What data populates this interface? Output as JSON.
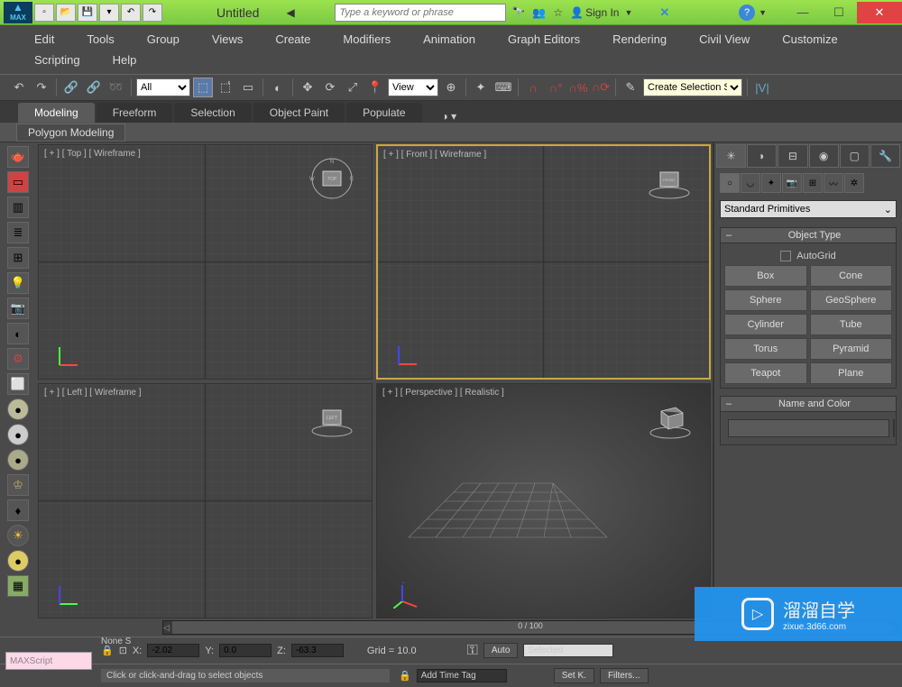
{
  "app": {
    "logo_text": "MAX",
    "title": "Untitled"
  },
  "titlebar": {
    "search_placeholder": "Type a keyword or phrase",
    "signin": "Sign In"
  },
  "menu": {
    "items": [
      "Edit",
      "Tools",
      "Group",
      "Views",
      "Create",
      "Modifiers",
      "Animation",
      "Graph Editors",
      "Rendering",
      "Civil View",
      "Customize",
      "Scripting",
      "Help"
    ]
  },
  "toolbar": {
    "filter_all": "All",
    "view_label": "View",
    "named_sel": "Create Selection Se"
  },
  "ribbon": {
    "tabs": [
      "Modeling",
      "Freeform",
      "Selection",
      "Object Paint",
      "Populate"
    ],
    "subtab": "Polygon Modeling"
  },
  "viewports": {
    "tl": "[ + ] [ Top ] [ Wireframe ]",
    "tr": "[ + ] [ Front ] [ Wireframe ]",
    "bl": "[ + ] [ Left ] [ Wireframe ]",
    "br": "[ + ] [ Perspective ] [ Realistic ]",
    "cube_top": "TOP",
    "cube_front": "FRONT",
    "cube_left": "LEFT"
  },
  "cmd": {
    "dropdown": "Standard Primitives",
    "rollout_obj": "Object Type",
    "autogrid": "AutoGrid",
    "buttons": [
      "Box",
      "Cone",
      "Sphere",
      "GeoSphere",
      "Cylinder",
      "Tube",
      "Torus",
      "Pyramid",
      "Teapot",
      "Plane"
    ],
    "rollout_name": "Name and Color"
  },
  "timeline": {
    "range": "0 / 100"
  },
  "status": {
    "none": "None S",
    "x_label": "X:",
    "x_val": "-2.02",
    "y_label": "Y:",
    "y_val": "0.0",
    "z_label": "Z:",
    "z_val": "-63.3",
    "grid": "Grid = 10.0",
    "auto": "Auto",
    "setk": "Set K.",
    "selected": "Selected",
    "filters": "Filters...",
    "addtag": "Add Time Tag",
    "hint": "Click or click-and-drag to select objects",
    "maxscript": "MAXScript"
  },
  "watermark": {
    "text": "溜溜自学",
    "url": "zixue.3d66.com"
  }
}
